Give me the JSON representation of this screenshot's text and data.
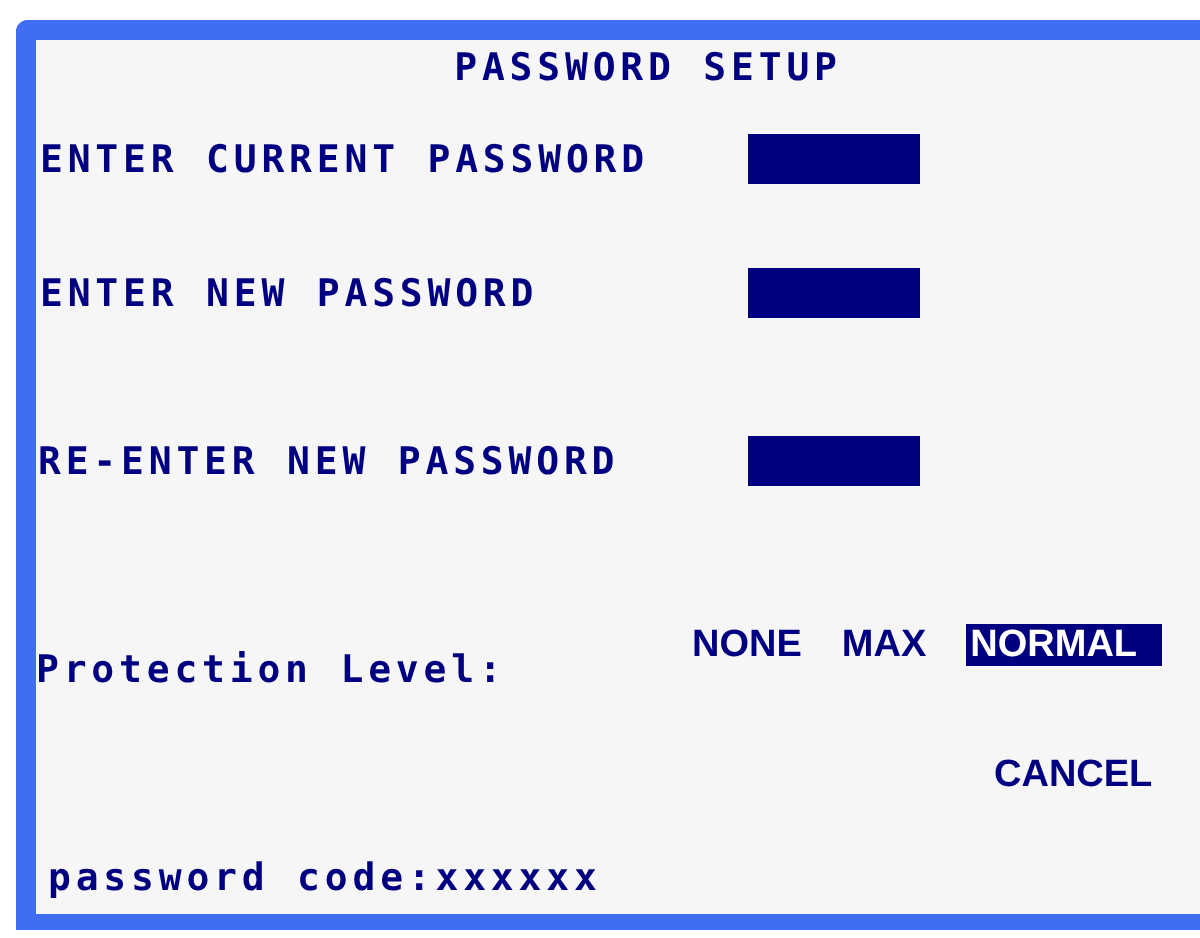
{
  "title": "PASSWORD SETUP",
  "fields": [
    {
      "label": "ENTER CURRENT PASSWORD"
    },
    {
      "label": "ENTER NEW PASSWORD"
    },
    {
      "label": "RE-ENTER NEW PASSWORD"
    }
  ],
  "protection": {
    "label": "Protection Level:",
    "options": [
      {
        "label": "NONE",
        "selected": false
      },
      {
        "label": "MAX",
        "selected": false
      },
      {
        "label": "NORMAL",
        "selected": true
      }
    ]
  },
  "cancel": "CANCEL",
  "code": "password code:xxxxxx"
}
